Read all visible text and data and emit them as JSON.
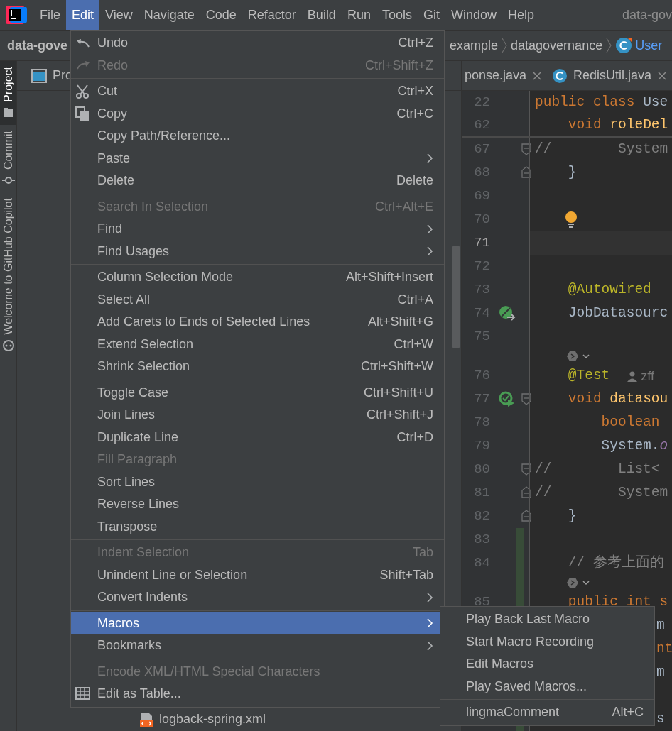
{
  "menubar": {
    "items": [
      {
        "label": "File",
        "selected": false
      },
      {
        "label": "Edit",
        "selected": true
      },
      {
        "label": "View",
        "selected": false
      },
      {
        "label": "Navigate",
        "selected": false
      },
      {
        "label": "Code",
        "selected": false
      },
      {
        "label": "Refactor",
        "selected": false
      },
      {
        "label": "Build",
        "selected": false
      },
      {
        "label": "Run",
        "selected": false
      },
      {
        "label": "Tools",
        "selected": false
      },
      {
        "label": "Git",
        "selected": false
      },
      {
        "label": "Window",
        "selected": false
      },
      {
        "label": "Help",
        "selected": false
      }
    ],
    "window_title": "data-gov"
  },
  "navbar": {
    "project": "data-gove",
    "breadcrumb": [
      {
        "label": "example",
        "kind": "package"
      },
      {
        "label": "datagovernance",
        "kind": "package"
      },
      {
        "label": "User",
        "kind": "class"
      }
    ]
  },
  "tool_strip": [
    {
      "label": "Project",
      "selected": true
    },
    {
      "label": "Commit",
      "selected": false
    },
    {
      "label": "Welcome to GitHub Copilot",
      "selected": false
    }
  ],
  "project_panel": {
    "title": "Pro",
    "files": [
      {
        "name": "logback-spring.xml"
      }
    ]
  },
  "editor": {
    "tabs": [
      {
        "label": "ponse.java",
        "selected": false,
        "kind": "plain"
      },
      {
        "label": "RedisUtil.java",
        "selected": false,
        "kind": "class"
      }
    ],
    "sticky_lines": [
      {
        "number": "22",
        "tokens": [
          {
            "text": "public class ",
            "kind": "keyword"
          },
          {
            "text": "Use",
            "kind": "plain"
          }
        ]
      },
      {
        "number": "62",
        "tokens": [
          {
            "text": "    void ",
            "kind": "keyword"
          },
          {
            "text": "roleDel",
            "kind": "method"
          }
        ]
      }
    ],
    "lines": [
      {
        "kind": "code",
        "number": "67",
        "fold_start": true,
        "changed": false,
        "tokens": [
          {
            "text": "//        System",
            "kind": "comment"
          }
        ]
      },
      {
        "kind": "code",
        "number": "68",
        "fold_end": true,
        "changed": false,
        "tokens": [
          {
            "text": "    }",
            "kind": "plain"
          }
        ]
      },
      {
        "kind": "code",
        "number": "69",
        "changed": false
      },
      {
        "kind": "code",
        "number": "70",
        "changed": false,
        "bulb": true
      },
      {
        "kind": "code",
        "number": "71",
        "changed": false,
        "current": true
      },
      {
        "kind": "code",
        "number": "72",
        "changed": false
      },
      {
        "kind": "code",
        "number": "73",
        "changed": false,
        "tokens": [
          {
            "text": "    @Autowired",
            "kind": "annotation"
          }
        ]
      },
      {
        "kind": "code",
        "number": "74",
        "bean_marker": true,
        "changed": false,
        "tokens": [
          {
            "text": "    JobDatasourc",
            "kind": "plain"
          }
        ]
      },
      {
        "kind": "code",
        "number": "75",
        "changed": false
      },
      {
        "kind": "inlay",
        "changed": false
      },
      {
        "kind": "code",
        "number": "76",
        "changed": false,
        "tokens": [
          {
            "text": "    @Test",
            "kind": "annotation"
          },
          {
            "text": "zff",
            "kind": "author"
          }
        ]
      },
      {
        "kind": "code",
        "number": "77",
        "run_marker": true,
        "fold_start": true,
        "changed": false,
        "tokens": [
          {
            "text": "    void ",
            "kind": "keyword"
          },
          {
            "text": "datasou",
            "kind": "method"
          }
        ]
      },
      {
        "kind": "code",
        "number": "78",
        "changed": false,
        "tokens": [
          {
            "text": "        boolean",
            "kind": "keyword"
          }
        ]
      },
      {
        "kind": "code",
        "number": "79",
        "changed": false,
        "tokens": [
          {
            "text": "        System.",
            "kind": "plain"
          },
          {
            "text": "o",
            "kind": "field"
          }
        ]
      },
      {
        "kind": "code",
        "number": "80",
        "fold_start": true,
        "changed": false,
        "tokens": [
          {
            "text": "//        List<",
            "kind": "comment"
          }
        ]
      },
      {
        "kind": "code",
        "number": "81",
        "fold_end": true,
        "changed": false,
        "tokens": [
          {
            "text": "//        System",
            "kind": "comment"
          }
        ]
      },
      {
        "kind": "code",
        "number": "82",
        "fold_end": true,
        "changed": false,
        "tokens": [
          {
            "text": "    }",
            "kind": "plain"
          }
        ]
      },
      {
        "kind": "code",
        "number": "83",
        "changed": true
      },
      {
        "kind": "code",
        "number": "84",
        "changed": true,
        "tokens": [
          {
            "text": "    // 参考上面的",
            "kind": "comment"
          }
        ]
      },
      {
        "kind": "inlay",
        "changed": true
      },
      {
        "kind": "code",
        "number": "85",
        "changed": true,
        "tokens": [
          {
            "text": "    public int s",
            "kind": "keyword"
          }
        ]
      },
      {
        "kind": "covered",
        "tokens": [
          {
            "text": "m",
            "kind": "plain"
          }
        ]
      },
      {
        "kind": "covered",
        "tokens": [
          {
            "text": "nt",
            "kind": "keyword"
          }
        ]
      },
      {
        "kind": "covered",
        "tokens": [
          {
            "text": "m",
            "kind": "plain"
          }
        ]
      },
      {
        "kind": "covered"
      },
      {
        "kind": "covered",
        "changed": true,
        "tokens": [
          {
            "text": "s",
            "kind": "plain"
          }
        ]
      }
    ]
  },
  "edit_menu": {
    "items": [
      {
        "kind": "item",
        "label": "Undo",
        "shortcut": "Ctrl+Z",
        "disabled": false,
        "submenu": false,
        "selected": false
      },
      {
        "kind": "item",
        "label": "Redo",
        "shortcut": "Ctrl+Shift+Z",
        "disabled": true,
        "submenu": false,
        "selected": false
      },
      {
        "kind": "separator"
      },
      {
        "kind": "item",
        "label": "Cut",
        "shortcut": "Ctrl+X",
        "disabled": false,
        "submenu": false,
        "selected": false
      },
      {
        "kind": "item",
        "label": "Copy",
        "shortcut": "Ctrl+C",
        "disabled": false,
        "submenu": false,
        "selected": false
      },
      {
        "kind": "item",
        "label": "Copy Path/Reference...",
        "disabled": false,
        "submenu": false,
        "selected": false
      },
      {
        "kind": "item",
        "label": "Paste",
        "disabled": false,
        "submenu": true,
        "selected": false
      },
      {
        "kind": "item",
        "label": "Delete",
        "shortcut": "Delete",
        "disabled": false,
        "submenu": false,
        "selected": false
      },
      {
        "kind": "separator"
      },
      {
        "kind": "item",
        "label": "Search In Selection",
        "shortcut": "Ctrl+Alt+E",
        "disabled": true,
        "submenu": false,
        "selected": false
      },
      {
        "kind": "item",
        "label": "Find",
        "disabled": false,
        "submenu": true,
        "selected": false
      },
      {
        "kind": "item",
        "label": "Find Usages",
        "disabled": false,
        "submenu": true,
        "selected": false
      },
      {
        "kind": "separator"
      },
      {
        "kind": "item",
        "label": "Column Selection Mode",
        "shortcut": "Alt+Shift+Insert",
        "disabled": false,
        "submenu": false,
        "selected": false
      },
      {
        "kind": "item",
        "label": "Select All",
        "shortcut": "Ctrl+A",
        "disabled": false,
        "submenu": false,
        "selected": false
      },
      {
        "kind": "item",
        "label": "Add Carets to Ends of Selected Lines",
        "shortcut": "Alt+Shift+G",
        "disabled": false,
        "submenu": false,
        "selected": false
      },
      {
        "kind": "item",
        "label": "Extend Selection",
        "shortcut": "Ctrl+W",
        "disabled": false,
        "submenu": false,
        "selected": false
      },
      {
        "kind": "item",
        "label": "Shrink Selection",
        "shortcut": "Ctrl+Shift+W",
        "disabled": false,
        "submenu": false,
        "selected": false
      },
      {
        "kind": "separator"
      },
      {
        "kind": "item",
        "label": "Toggle Case",
        "shortcut": "Ctrl+Shift+U",
        "disabled": false,
        "submenu": false,
        "selected": false
      },
      {
        "kind": "item",
        "label": "Join Lines",
        "shortcut": "Ctrl+Shift+J",
        "disabled": false,
        "submenu": false,
        "selected": false
      },
      {
        "kind": "item",
        "label": "Duplicate Line",
        "shortcut": "Ctrl+D",
        "disabled": false,
        "submenu": false,
        "selected": false
      },
      {
        "kind": "item",
        "label": "Fill Paragraph",
        "disabled": true,
        "submenu": false,
        "selected": false
      },
      {
        "kind": "item",
        "label": "Sort Lines",
        "disabled": false,
        "submenu": false,
        "selected": false
      },
      {
        "kind": "item",
        "label": "Reverse Lines",
        "disabled": false,
        "submenu": false,
        "selected": false
      },
      {
        "kind": "item",
        "label": "Transpose",
        "disabled": false,
        "submenu": false,
        "selected": false
      },
      {
        "kind": "separator"
      },
      {
        "kind": "item",
        "label": "Indent Selection",
        "shortcut": "Tab",
        "disabled": true,
        "submenu": false,
        "selected": false
      },
      {
        "kind": "item",
        "label": "Unindent Line or Selection",
        "shortcut": "Shift+Tab",
        "disabled": false,
        "submenu": false,
        "selected": false
      },
      {
        "kind": "item",
        "label": "Convert Indents",
        "disabled": false,
        "submenu": true,
        "selected": false
      },
      {
        "kind": "separator"
      },
      {
        "kind": "item",
        "label": "Macros",
        "disabled": false,
        "submenu": true,
        "selected": true
      },
      {
        "kind": "item",
        "label": "Bookmarks",
        "disabled": false,
        "submenu": true,
        "selected": false
      },
      {
        "kind": "separator"
      },
      {
        "kind": "item",
        "label": "Encode XML/HTML Special Characters",
        "disabled": true,
        "submenu": false,
        "selected": false
      },
      {
        "kind": "item",
        "label": "Edit as Table...",
        "disabled": false,
        "submenu": false,
        "selected": false
      }
    ]
  },
  "macros_submenu": {
    "items": [
      {
        "kind": "item",
        "label": "Play Back Last Macro",
        "disabled": false,
        "selected": false
      },
      {
        "kind": "item",
        "label": "Start Macro Recording",
        "disabled": false,
        "selected": false
      },
      {
        "kind": "item",
        "label": "Edit Macros",
        "disabled": false,
        "selected": false
      },
      {
        "kind": "item",
        "label": "Play Saved Macros...",
        "disabled": false,
        "selected": false
      },
      {
        "kind": "separator"
      },
      {
        "kind": "item",
        "label": "lingmaComment",
        "shortcut": "Alt+C",
        "disabled": false,
        "selected": false
      }
    ]
  }
}
